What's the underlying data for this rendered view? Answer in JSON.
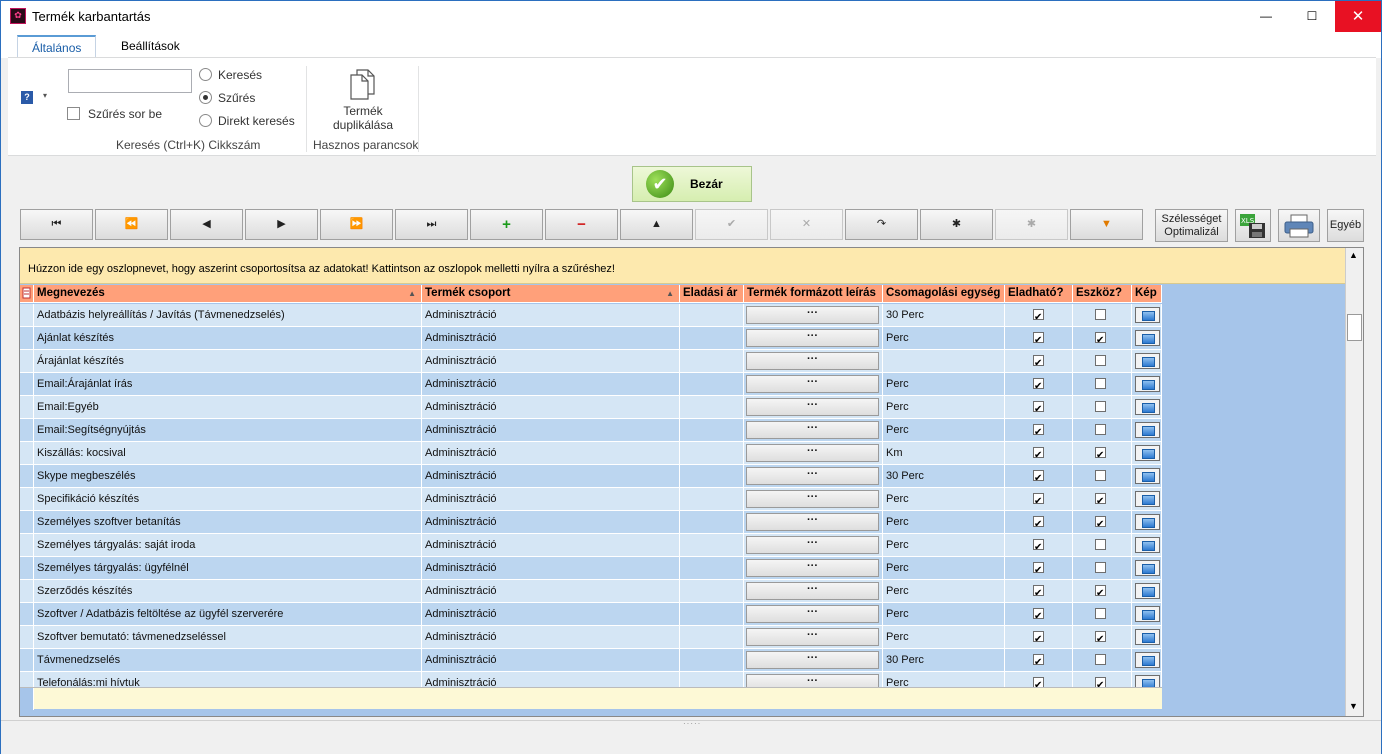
{
  "window": {
    "title": "Termék karbantartás",
    "minimize": "—",
    "maximize": "☐",
    "close": "✕"
  },
  "ribbon": {
    "tabs": [
      "Általános",
      "Beállítások"
    ],
    "search_value": "",
    "filter_row_label": "Szűrés sor be",
    "radio_options": [
      {
        "label": "Keresés",
        "selected": false
      },
      {
        "label": "Szűrés",
        "selected": true
      },
      {
        "label": "Direkt keresés",
        "selected": false
      }
    ],
    "search_group_label": "Keresés (Ctrl+K) Cikkszám",
    "duplicate_label_1": "Termék",
    "duplicate_label_2": "duplikálása",
    "useful_group_label": "Hasznos parancsok"
  },
  "toolbar": {
    "close_label": "Bezár",
    "nav_buttons": [
      "⏮",
      "⏪",
      "◀",
      "▶",
      "⏩",
      "⏭",
      "+",
      "−",
      "▲",
      "✔",
      "✕",
      "↷",
      "✱",
      "✱",
      "▼"
    ],
    "width_optimize_1": "Szélességet",
    "width_optimize_2": "Optimalizál",
    "other_label": "Egyéb"
  },
  "grid": {
    "group_hint": "Húzzon ide egy oszlopnevet, hogy aszerint csoportosítsa az adatokat! Kattintson az oszlopok melletti nyílra a szűréshez!",
    "headers": [
      "Megnevezés",
      "Termék csoport",
      "Eladási ár",
      "Termék formázott leírás",
      "Csomagolási egység",
      "Eladható?",
      "Eszköz?",
      "Kép"
    ],
    "ellipsis": "···",
    "rows": [
      {
        "name": "Adatbázis helyreállítás / Javítás (Távmenedzselés)",
        "group": "Adminisztráció",
        "price": "",
        "unit": "30 Perc",
        "sellable": true,
        "tool": false
      },
      {
        "name": "Ajánlat készítés",
        "group": "Adminisztráció",
        "price": "",
        "unit": "Perc",
        "sellable": true,
        "tool": true
      },
      {
        "name": "Árajánlat készítés",
        "group": "Adminisztráció",
        "price": "",
        "unit": "",
        "sellable": true,
        "tool": false
      },
      {
        "name": "Email:Árajánlat írás",
        "group": "Adminisztráció",
        "price": "",
        "unit": "Perc",
        "sellable": true,
        "tool": false
      },
      {
        "name": "Email:Egyéb",
        "group": "Adminisztráció",
        "price": "",
        "unit": "Perc",
        "sellable": true,
        "tool": false
      },
      {
        "name": "Email:Segítségnyújtás",
        "group": "Adminisztráció",
        "price": "",
        "unit": "Perc",
        "sellable": true,
        "tool": false
      },
      {
        "name": "Kiszállás: kocsival",
        "group": "Adminisztráció",
        "price": "",
        "unit": "Km",
        "sellable": true,
        "tool": true
      },
      {
        "name": "Skype megbeszélés",
        "group": "Adminisztráció",
        "price": "",
        "unit": "30 Perc",
        "sellable": true,
        "tool": false
      },
      {
        "name": "Specifikáció készítés",
        "group": "Adminisztráció",
        "price": "",
        "unit": "Perc",
        "sellable": true,
        "tool": true
      },
      {
        "name": "Személyes szoftver betanítás",
        "group": "Adminisztráció",
        "price": "",
        "unit": "Perc",
        "sellable": true,
        "tool": true
      },
      {
        "name": "Személyes tárgyalás: saját iroda",
        "group": "Adminisztráció",
        "price": "",
        "unit": "Perc",
        "sellable": true,
        "tool": false
      },
      {
        "name": "Személyes tárgyalás: ügyfélnél",
        "group": "Adminisztráció",
        "price": "",
        "unit": "Perc",
        "sellable": true,
        "tool": false
      },
      {
        "name": "Szerződés készítés",
        "group": "Adminisztráció",
        "price": "",
        "unit": "Perc",
        "sellable": true,
        "tool": true
      },
      {
        "name": "Szoftver / Adatbázis feltöltése az ügyfél szerverére",
        "group": "Adminisztráció",
        "price": "",
        "unit": "Perc",
        "sellable": true,
        "tool": false
      },
      {
        "name": "Szoftver bemutató: távmenedzseléssel",
        "group": "Adminisztráció",
        "price": "",
        "unit": "Perc",
        "sellable": true,
        "tool": true
      },
      {
        "name": "Távmenedzselés",
        "group": "Adminisztráció",
        "price": "",
        "unit": "30 Perc",
        "sellable": true,
        "tool": false
      },
      {
        "name": "Telefonálás:mi hívtuk",
        "group": "Adminisztráció",
        "price": "",
        "unit": "Perc",
        "sellable": true,
        "tool": true
      }
    ]
  },
  "colors": {
    "header_bg": "#ffa07a",
    "row_a": "#d5e6f5",
    "row_b": "#bcd6f0",
    "group_bar": "#fde9ae"
  }
}
